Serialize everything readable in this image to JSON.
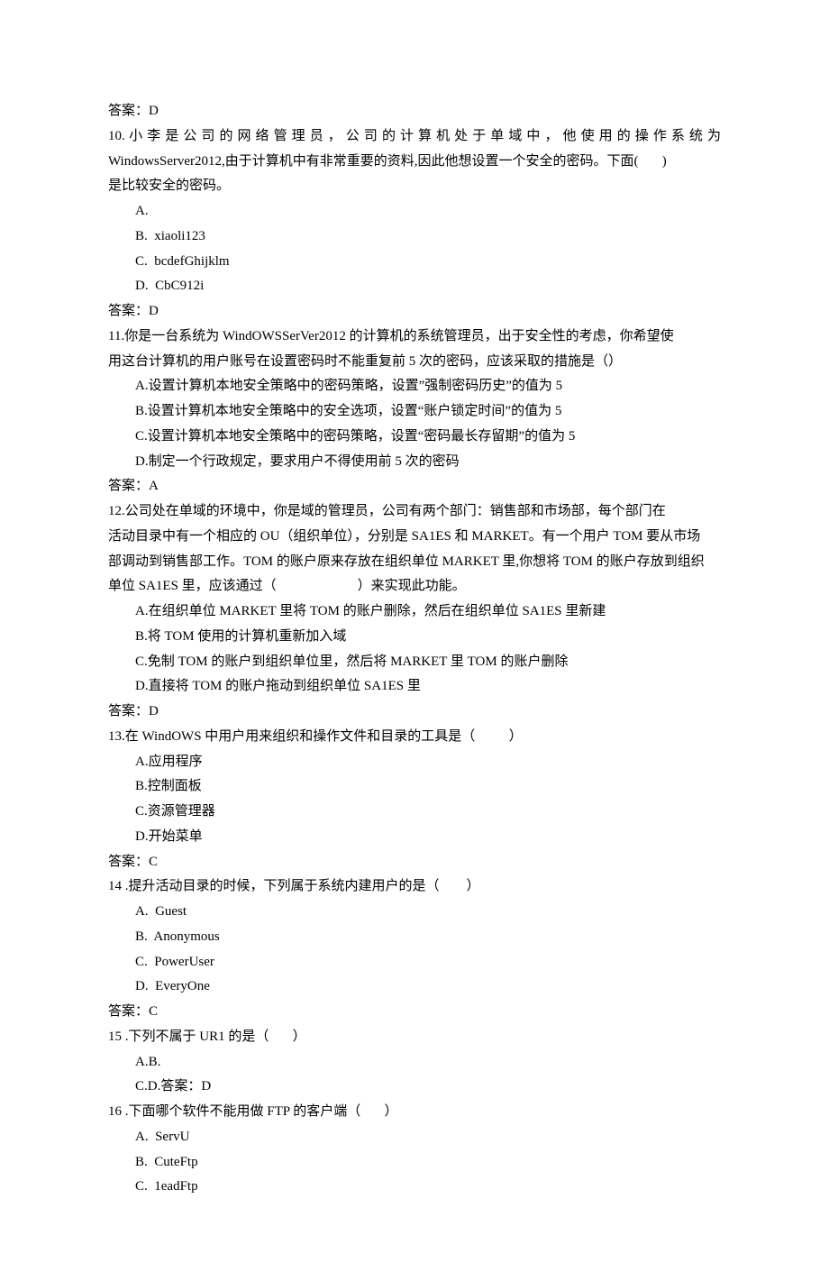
{
  "lines": {
    "a9": "答案：D",
    "q10_1": "10. 小 李 是 公 司 的 网 络 管 理 员 ， 公 司 的 计 算 机 处 于 单 域 中 ， 他 使 用 的 操 作 系 统 为",
    "q10_2": "WindowsServer2012,由于计算机中有非常重要的资料,因此他想设置一个安全的密码。下面(       )",
    "q10_3": "是比较安全的密码。",
    "q10_A": "A.",
    "q10_B": "B.  xiaoli123",
    "q10_C": "C.  bcdefGhijklm",
    "q10_D": "D.  CbC912i",
    "a10": "答案：D",
    "q11_1": "11.你是一台系统为 WindOWSSerVer2012 的计算机的系统管理员，出于安全性的考虑，你希望使",
    "q11_2": "用这台计算机的用户账号在设置密码时不能重复前 5 次的密码，应该采取的措施是（）",
    "q11_A": "A.设置计算机本地安全策略中的密码策略，设置”强制密码历史”的值为 5",
    "q11_B": "B.设置计算机本地安全策略中的安全选项，设置“账户锁定时间”的值为 5",
    "q11_C": "C.设置计算机本地安全策略中的密码策略，设置“密码最长存留期”的值为 5",
    "q11_D": "D.制定一个行政规定，要求用户不得使用前 5 次的密码",
    "a11": "答案：A",
    "q12_1": "12.公司处在单域的环境中，你是域的管理员，公司有两个部门：销售部和市场部，每个部门在",
    "q12_2": "活动目录中有一个相应的 OU（组织单位），分别是 SA1ES 和 MARKET。有一个用户 TOM 要从市场",
    "q12_3": "部调动到销售部工作。TOM 的账户原来存放在组织单位 MARKET 里,你想将 TOM 的账户存放到组织",
    "q12_4": "单位 SA1ES 里，应该通过（                        ）来实现此功能。",
    "q12_A": "A.在组织单位 MARKET 里将 TOM 的账户删除，然后在组织单位 SA1ES 里新建",
    "q12_B": "B.将 TOM 使用的计算机重新加入域",
    "q12_C": "C.免制 TOM 的账户到组织单位里，然后将 MARKET 里 TOM 的账户删除",
    "q12_D": "D.直接将 TOM 的账户拖动到组织单位 SA1ES 里",
    "a12": "答案：D",
    "q13_1": "13.在 WindOWS 中用户用来组织和操作文件和目录的工具是（          ）",
    "q13_A": "A.应用程序",
    "q13_B": "B.控制面板",
    "q13_C": "C.资源管理器",
    "q13_D": "D.开始菜单",
    "a13": "答案：C",
    "q14_1": "14 .提升活动目录的时候，下列属于系统内建用户的是（        ）",
    "q14_A": "A.  Guest",
    "q14_B": "B.  Anonymous",
    "q14_C": "C.  PowerUser",
    "q14_D": "D.  EveryOne",
    "a14": "答案：C",
    "q15_1": "15 .下列不属于 UR1 的是（       ）",
    "q15_AB": "A.B.",
    "q15_CD": "C.D.答案：D",
    "q16_1": "16 .下面哪个软件不能用做 FTP 的客户端（       ）",
    "q16_A": "A.  ServU",
    "q16_B": "B.  CuteFtp",
    "q16_C": "C.  1eadFtp"
  }
}
